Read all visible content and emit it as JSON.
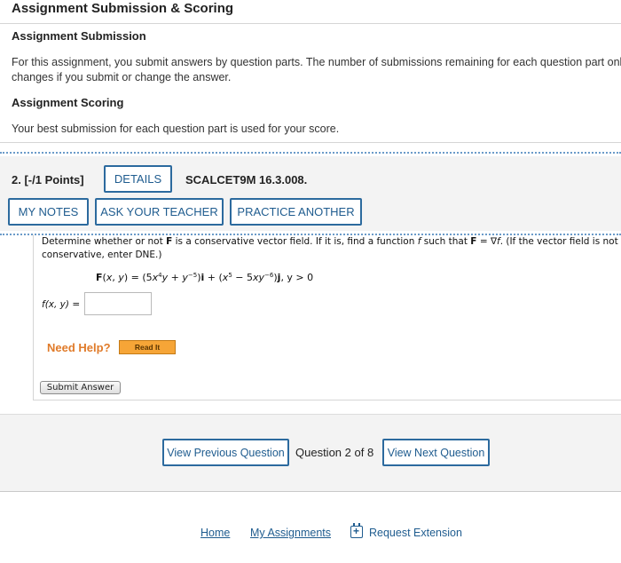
{
  "page": {
    "title": "Assignment Submission & Scoring"
  },
  "submission": {
    "heading": "Assignment Submission",
    "text_line1": "For this assignment, you submit answers by question parts. The number of submissions remaining for each question part only",
    "text_line2": "changes if you submit or change the answer."
  },
  "scoring": {
    "heading": "Assignment Scoring",
    "text": "Your best submission for each question part is used for your score."
  },
  "question": {
    "number": "2.  [-/1 Points]",
    "details_label": "DETAILS",
    "code": "SCALCET9M 16.3.008.",
    "my_notes_label": "MY NOTES",
    "ask_teacher_label": "ASK YOUR TEACHER",
    "practice_label": "PRACTICE ANOTHER",
    "prompt_line2": "conservative, enter DNE.)",
    "formula_suffix": ",   y > 0",
    "answer_label": "f(x, y) =",
    "answer_value": "",
    "need_help": "Need Help?",
    "read_it": "Read It",
    "submit_label": "Submit Answer"
  },
  "navigation": {
    "prev_label": "View Previous Question",
    "count": "Question 2 of 8",
    "next_label": "View Next Question"
  },
  "footer": {
    "home": "Home",
    "assignments": "My Assignments",
    "extension": "Request Extension"
  },
  "colors": {
    "accent": "#2c6a9e",
    "link": "#1f5c8f",
    "help": "#e07b2a",
    "readit": "#f6a537"
  }
}
